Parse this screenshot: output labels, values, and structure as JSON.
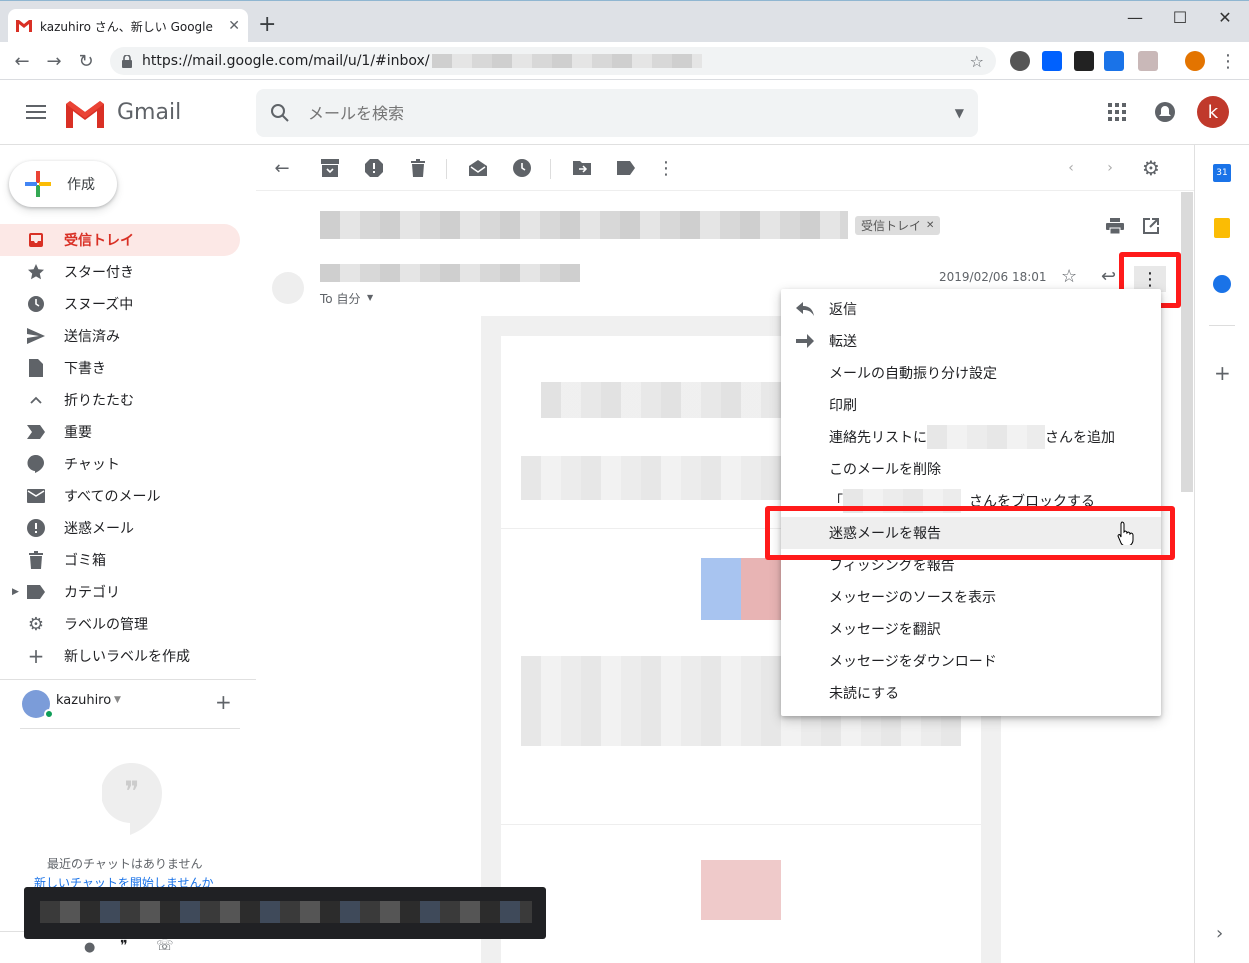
{
  "browser": {
    "tab_title": "kazuhiro さん、新しい Google アカウ",
    "url": "https://mail.google.com/mail/u/1/#inbox/"
  },
  "gmail": {
    "logo_text": "Gmail",
    "search_placeholder": "メールを検索",
    "account_initial": "k"
  },
  "sidebar": {
    "compose_label": "作成",
    "items": [
      {
        "label": "受信トレイ",
        "icon": "inbox-icon"
      },
      {
        "label": "スター付き",
        "icon": "star-icon"
      },
      {
        "label": "スヌーズ中",
        "icon": "clock-icon"
      },
      {
        "label": "送信済み",
        "icon": "send-icon"
      },
      {
        "label": "下書き",
        "icon": "draft-icon"
      },
      {
        "label": "折りたたむ",
        "icon": "chevron-up-icon"
      },
      {
        "label": "重要",
        "icon": "important-icon"
      },
      {
        "label": "チャット",
        "icon": "chat-icon"
      },
      {
        "label": "すべてのメール",
        "icon": "mail-icon"
      },
      {
        "label": "迷惑メール",
        "icon": "spam-icon"
      },
      {
        "label": "ゴミ箱",
        "icon": "trash-icon"
      },
      {
        "label": "カテゴリ",
        "icon": "label-icon"
      },
      {
        "label": "ラベルの管理",
        "icon": "gear-icon"
      },
      {
        "label": "新しいラベルを作成",
        "icon": "plus-icon"
      }
    ],
    "hangouts_user": "kazuhiro",
    "no_chats_text": "最近のチャットはありません",
    "start_chat_link": "新しいチャットを開始しませんか"
  },
  "message": {
    "inbox_chip": "受信トレイ",
    "recipient": "To 自分",
    "date": "2019/02/06 18:01"
  },
  "menu": {
    "items": [
      {
        "label": "返信",
        "icon": "reply-icon"
      },
      {
        "label": "転送",
        "icon": "forward-icon"
      },
      {
        "label": "メールの自動振り分け設定",
        "icon": ""
      },
      {
        "label": "印刷",
        "icon": ""
      },
      {
        "label": "連絡先リストに",
        "suffix": "さんを追加",
        "icon": ""
      },
      {
        "label": "このメールを削除",
        "icon": ""
      },
      {
        "label": "「",
        "suffix": "さんをブロックする",
        "icon": ""
      },
      {
        "label": "迷惑メールを報告",
        "icon": ""
      },
      {
        "label": "フィッシングを報告",
        "icon": ""
      },
      {
        "label": "メッセージのソースを表示",
        "icon": ""
      },
      {
        "label": "メッセージを翻訳",
        "icon": ""
      },
      {
        "label": "メッセージをダウンロード",
        "icon": ""
      },
      {
        "label": "未読にする",
        "icon": ""
      }
    ]
  },
  "colors": {
    "accent_red": "#d93025",
    "highlight_red": "#ff1a1a"
  }
}
